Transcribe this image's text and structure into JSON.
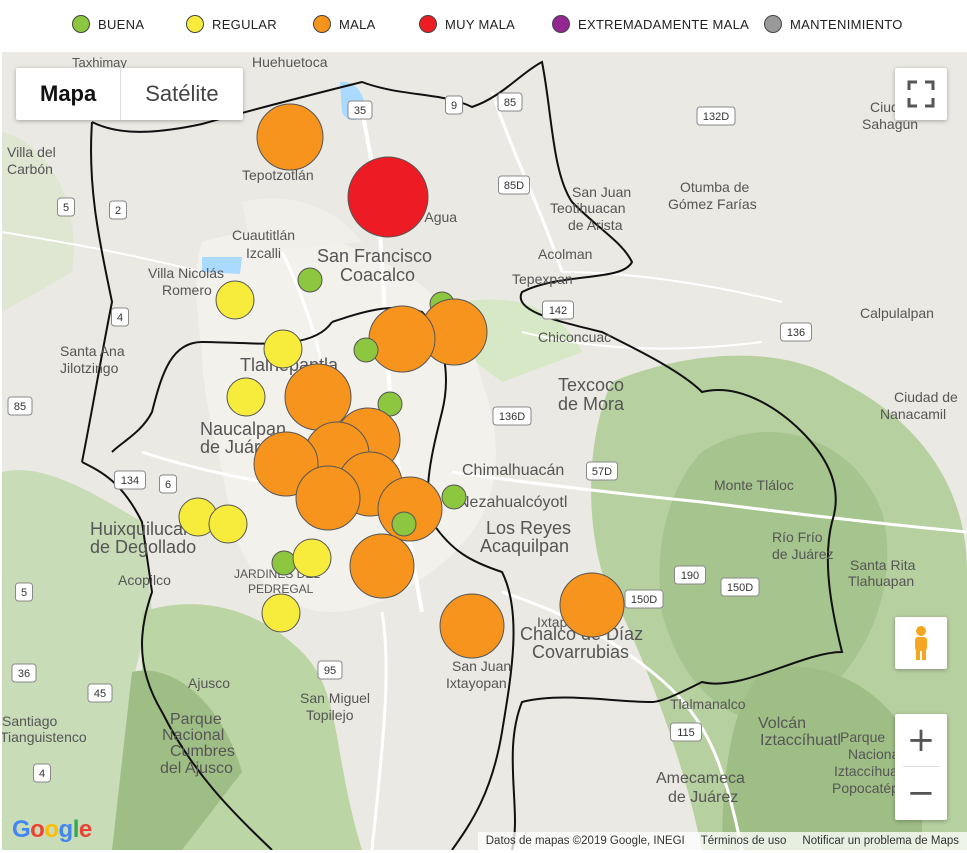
{
  "legend": [
    {
      "label": "BUENA",
      "color": "#8dc63f"
    },
    {
      "label": "REGULAR",
      "color": "#f7ec3c"
    },
    {
      "label": "MALA",
      "color": "#f7941d"
    },
    {
      "label": "MUY MALA",
      "color": "#ed1c24"
    },
    {
      "label": "EXTREMADAMENTE MALA",
      "color": "#92278f"
    },
    {
      "label": "MANTENIMIENTO",
      "color": "#999999"
    }
  ],
  "map_type": {
    "map_label": "Mapa",
    "satellite_label": "Satélite",
    "selected": "Mapa"
  },
  "controls": {
    "fullscreen_icon": "fullscreen-icon",
    "pegman_icon": "pegman-icon",
    "zoom_in": "+",
    "zoom_out": "−"
  },
  "attribution": {
    "data": "Datos de mapas ©2019 Google, INEGI",
    "terms": "Términos de uso",
    "report": "Notificar un problema de Maps"
  },
  "logo": "Google",
  "place_labels": [
    {
      "text": "Taxhimay"
    },
    {
      "text": "Huehuetoca"
    },
    {
      "text": "Villa del"
    },
    {
      "text": "Carbón"
    },
    {
      "text": "Tepotzotlán"
    },
    {
      "text": "Cuautitlán"
    },
    {
      "text": "Izcalli"
    },
    {
      "text": "San Francisco"
    },
    {
      "text": "Coacalco"
    },
    {
      "text": "Ojo de Agua"
    },
    {
      "text": "San Juan"
    },
    {
      "text": "Teotihuacan"
    },
    {
      "text": "de Arista"
    },
    {
      "text": "Otumba de"
    },
    {
      "text": "Gómez Farías"
    },
    {
      "text": "Ciudad"
    },
    {
      "text": "Sahagún"
    },
    {
      "text": "Villa Nicolás"
    },
    {
      "text": "Romero"
    },
    {
      "text": "Acolman"
    },
    {
      "text": "Tepexpan"
    },
    {
      "text": "Calpulalpan"
    },
    {
      "text": "Santa Ana"
    },
    {
      "text": "Jilotzingo"
    },
    {
      "text": "Tlalnepantla"
    },
    {
      "text": "Chiconcuac"
    },
    {
      "text": "Texcoco"
    },
    {
      "text": "de Mora"
    },
    {
      "text": "Ciudad de"
    },
    {
      "text": "Nanacamil"
    },
    {
      "text": "Naucalpan"
    },
    {
      "text": "de Juárez"
    },
    {
      "text": "Chimalhuacán"
    },
    {
      "text": "Monte Tláloc"
    },
    {
      "text": "Nezahualcóyotl"
    },
    {
      "text": "Huixquilucan"
    },
    {
      "text": "de Degollado"
    },
    {
      "text": "Los Reyes"
    },
    {
      "text": "Acaquilpan"
    },
    {
      "text": "Río Frío"
    },
    {
      "text": "de Juárez"
    },
    {
      "text": "Santa Rita"
    },
    {
      "text": "Tlahuapan"
    },
    {
      "text": "Acopilco"
    },
    {
      "text": "JARDINES DEL"
    },
    {
      "text": "PEDREGAL"
    },
    {
      "text": "Ixtapaluca"
    },
    {
      "text": "Chalco de Díaz"
    },
    {
      "text": "Covarrubias"
    },
    {
      "text": "San Juan"
    },
    {
      "text": "Ixtayopan"
    },
    {
      "text": "Ajusco"
    },
    {
      "text": "San Miguel"
    },
    {
      "text": "Topilejo"
    },
    {
      "text": "Tlalmanalco"
    },
    {
      "text": "Parque"
    },
    {
      "text": "Nacional"
    },
    {
      "text": "Cumbres"
    },
    {
      "text": "del Ajusco"
    },
    {
      "text": "Volcán"
    },
    {
      "text": "Iztaccíhuatl"
    },
    {
      "text": "Santiago"
    },
    {
      "text": "Tianguistenco"
    },
    {
      "text": "Amecameca"
    },
    {
      "text": "de Juárez"
    },
    {
      "text": "Parque"
    },
    {
      "text": "Nacional"
    },
    {
      "text": "Iztaccíhuatl"
    },
    {
      "text": "Popocatépetl"
    }
  ],
  "road_shields": [
    "35",
    "9",
    "85",
    "132D",
    "5",
    "2",
    "85D",
    "4",
    "142",
    "136",
    "85",
    "136D",
    "57D",
    "134",
    "6",
    "190",
    "150D",
    "150D",
    "95",
    "115",
    "36",
    "45",
    "4",
    "5"
  ],
  "stations": [
    {
      "category": "MALA"
    },
    {
      "category": "MUY MALA"
    },
    {
      "category": "BUENA"
    },
    {
      "category": "REGULAR"
    },
    {
      "category": "BUENA"
    },
    {
      "category": "MALA"
    },
    {
      "category": "MALA"
    },
    {
      "category": "REGULAR"
    },
    {
      "category": "BUENA"
    },
    {
      "category": "REGULAR"
    },
    {
      "category": "MALA"
    },
    {
      "category": "BUENA"
    },
    {
      "category": "MALA"
    },
    {
      "category": "MALA"
    },
    {
      "category": "MALA"
    },
    {
      "category": "MALA"
    },
    {
      "category": "MALA"
    },
    {
      "category": "MALA"
    },
    {
      "category": "BUENA"
    },
    {
      "category": "REGULAR"
    },
    {
      "category": "REGULAR"
    },
    {
      "category": "BUENA"
    },
    {
      "category": "REGULAR"
    },
    {
      "category": "MALA"
    },
    {
      "category": "REGULAR"
    },
    {
      "category": "MALA"
    },
    {
      "category": "MALA"
    },
    {
      "category": "BUENA"
    }
  ]
}
